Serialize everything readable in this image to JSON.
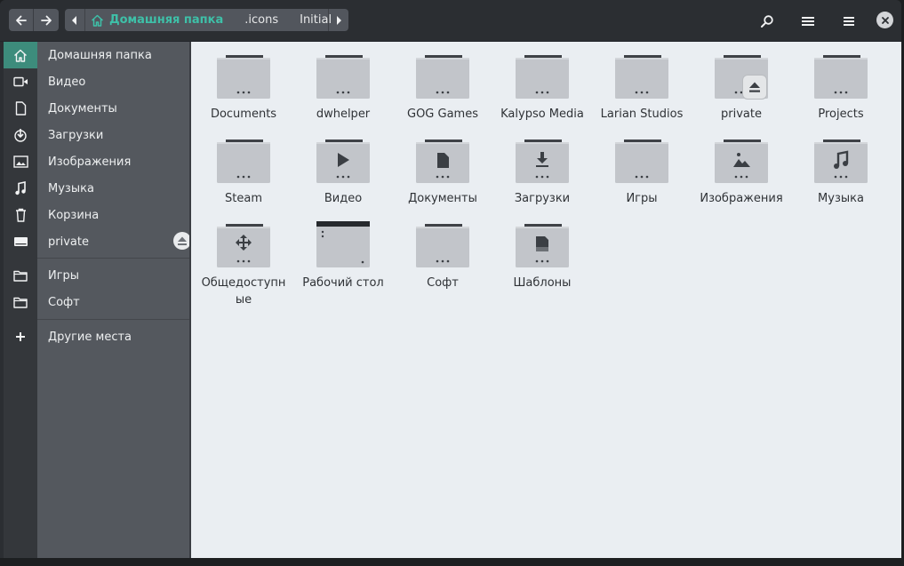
{
  "nav": {
    "back_icon": "arrow-left-icon",
    "forward_icon": "arrow-right-icon"
  },
  "pathbar": {
    "crumbs": [
      "Домашняя папка",
      ".icons",
      "Initial"
    ],
    "active_color": "#3ec0a8"
  },
  "toolbar": {
    "search_icon": "search-icon",
    "view_icon": "list-view-icon",
    "menu_icon": "menu-icon",
    "close_icon": "close-icon"
  },
  "sidebar": {
    "places": [
      {
        "label": "Домашняя папка",
        "icon": "home-icon"
      },
      {
        "label": "Видео",
        "icon": "video-icon"
      },
      {
        "label": "Документы",
        "icon": "document-icon"
      },
      {
        "label": "Загрузки",
        "icon": "download-icon"
      },
      {
        "label": "Изображения",
        "icon": "image-icon"
      },
      {
        "label": "Музыка",
        "icon": "music-icon"
      },
      {
        "label": "Корзина",
        "icon": "trash-icon"
      },
      {
        "label": "private",
        "icon": "drive-icon"
      }
    ],
    "bookmarks": [
      {
        "label": "Игры",
        "icon": "folder-icon"
      },
      {
        "label": "Софт",
        "icon": "folder-icon"
      }
    ],
    "other": {
      "label": "Другие места",
      "icon": "plus-icon"
    }
  },
  "files": [
    {
      "name": "Documents",
      "icon": "folder"
    },
    {
      "name": "dwhelper",
      "icon": "folder"
    },
    {
      "name": "GOG Games",
      "icon": "folder"
    },
    {
      "name": "Kalypso Media",
      "icon": "folder"
    },
    {
      "name": "Larian Studios",
      "icon": "folder"
    },
    {
      "name": "private",
      "icon": "folder"
    },
    {
      "name": "Projects",
      "icon": "folder"
    },
    {
      "name": "Steam",
      "icon": "folder"
    },
    {
      "name": "Видео",
      "icon": "folder-video"
    },
    {
      "name": "Документы",
      "icon": "folder-documents"
    },
    {
      "name": "Загрузки",
      "icon": "folder-download"
    },
    {
      "name": "Игры",
      "icon": "folder"
    },
    {
      "name": "Изображения",
      "icon": "folder-pictures"
    },
    {
      "name": "Музыка",
      "icon": "folder-music"
    },
    {
      "name": "Общедоступные",
      "icon": "folder-public"
    },
    {
      "name": "Рабочий стол",
      "icon": "folder-desktop"
    },
    {
      "name": "Софт",
      "icon": "folder"
    },
    {
      "name": "Шаблоны",
      "icon": "folder-templates"
    }
  ]
}
